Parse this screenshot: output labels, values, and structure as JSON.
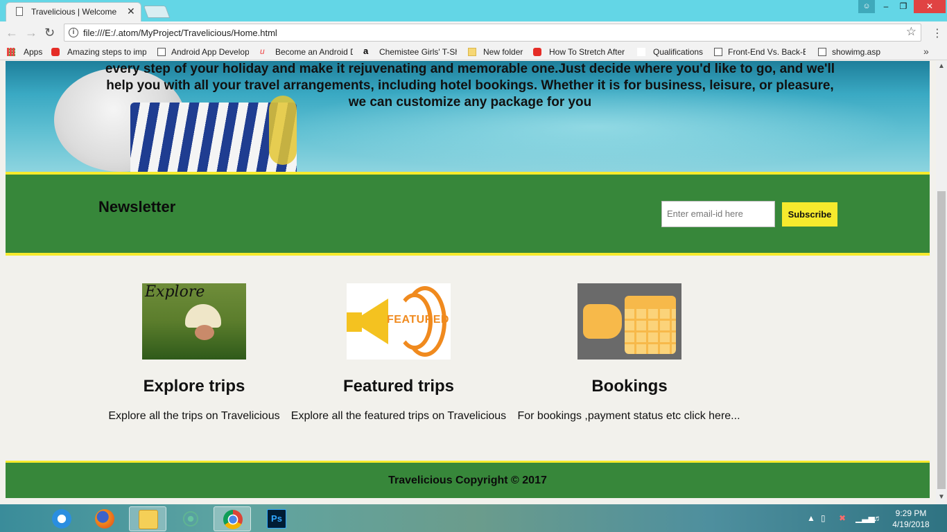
{
  "browser": {
    "tab_title": "Travelicious | Welcome",
    "tab_close": "✕",
    "url": "file:///E:/.atom/MyProject/Travelicious/Home.html",
    "window_controls": {
      "minimize": "–",
      "maximize": "❐",
      "close": "✕"
    },
    "bookmarks": [
      {
        "label": "Apps",
        "icon": "apps-grid-icon"
      },
      {
        "label": "Amazing steps to imp",
        "icon": "youtube-icon"
      },
      {
        "label": "Android App Develop",
        "icon": "page-icon"
      },
      {
        "label": "Become an Android D",
        "icon": "udacity-icon"
      },
      {
        "label": "Chemistee Girls' T-Sh",
        "icon": "amazon-icon"
      },
      {
        "label": "New folder",
        "icon": "folder-icon"
      },
      {
        "label": "How To Stretch After",
        "icon": "youtube-icon"
      },
      {
        "label": "Qualifications",
        "icon": "blank-icon"
      },
      {
        "label": "Front-End Vs. Back-E",
        "icon": "page-icon"
      },
      {
        "label": "showimg.asp",
        "icon": "page-icon"
      }
    ],
    "bookmarks_more": "»"
  },
  "hero": {
    "text": "every step of your holiday and make it rejuvenating and memorable one.Just decide where you'd like to go, and we'll help you with all your travel arrangements, including hotel bookings. Whether it is for business, leisure, or pleasure, we can customize any package for you"
  },
  "newsletter": {
    "title": "Newsletter",
    "email_placeholder": "Enter email-id here",
    "subscribe_label": "Subscribe"
  },
  "features": [
    {
      "image_label": "Explore",
      "title": "Explore trips",
      "description": "Explore all the trips on Travelicious"
    },
    {
      "image_label": "FEATURED",
      "title": "Featured trips",
      "description": "Explore all the featured trips on Travelicious"
    },
    {
      "title": "Bookings",
      "description": "For bookings ,payment status etc click here..."
    }
  ],
  "footer": {
    "copyright": "Travelicious Copyright © 2017"
  },
  "taskbar": {
    "apps": [
      "internet-explorer-icon",
      "firefox-icon",
      "file-explorer-icon",
      "atom-icon",
      "chrome-icon",
      "photoshop-icon"
    ],
    "clock_time": "9:29 PM",
    "clock_date": "4/19/2018"
  },
  "colors": {
    "green": "#37873a",
    "yellow": "#f6ea2d",
    "chrome_cyan": "#63d6e6"
  }
}
